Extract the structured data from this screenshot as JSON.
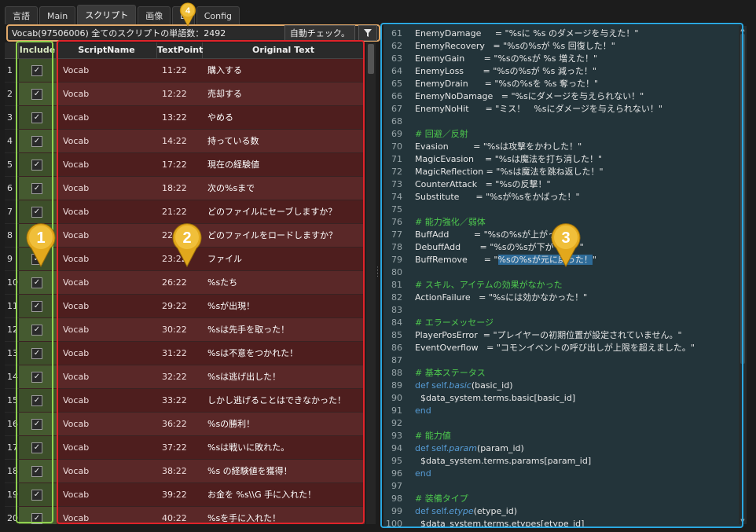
{
  "tabs": [
    "言語",
    "Main",
    "スクリプト",
    "画像",
    "D",
    "Config"
  ],
  "active_tab_index": 2,
  "toolbar": {
    "summary": "Vocab(97506006)  全てのスクリプトの単語数：2492",
    "auto_check_label": "自動チェック。",
    "filter_icon": "filter-icon"
  },
  "grid": {
    "headers": {
      "include": "Include",
      "script_name": "ScriptName",
      "text_point": "TextPoint",
      "original_text": "Original Text"
    },
    "rows": [
      {
        "idx": "1",
        "name": "Vocab",
        "tp": "11:22",
        "text": "購入する"
      },
      {
        "idx": "2",
        "name": "Vocab",
        "tp": "12:22",
        "text": "売却する"
      },
      {
        "idx": "3",
        "name": "Vocab",
        "tp": "13:22",
        "text": "やめる"
      },
      {
        "idx": "4",
        "name": "Vocab",
        "tp": "14:22",
        "text": "持っている数"
      },
      {
        "idx": "5",
        "name": "Vocab",
        "tp": "17:22",
        "text": "現在の経験値"
      },
      {
        "idx": "6",
        "name": "Vocab",
        "tp": "18:22",
        "text": "次の%sまで"
      },
      {
        "idx": "7",
        "name": "Vocab",
        "tp": "21:22",
        "text": "どのファイルにセーブしますか？"
      },
      {
        "idx": "8",
        "name": "Vocab",
        "tp": "22:22",
        "text": "どのファイルをロードしますか？"
      },
      {
        "idx": "9",
        "name": "Vocab",
        "tp": "23:22",
        "text": "ファイル"
      },
      {
        "idx": "10",
        "name": "Vocab",
        "tp": "26:22",
        "text": "%sたち"
      },
      {
        "idx": "11",
        "name": "Vocab",
        "tp": "29:22",
        "text": "%sが出現！"
      },
      {
        "idx": "12",
        "name": "Vocab",
        "tp": "30:22",
        "text": "%sは先手を取った！"
      },
      {
        "idx": "13",
        "name": "Vocab",
        "tp": "31:22",
        "text": "%sは不意をつかれた！"
      },
      {
        "idx": "14",
        "name": "Vocab",
        "tp": "32:22",
        "text": "%sは逃げ出した！"
      },
      {
        "idx": "15",
        "name": "Vocab",
        "tp": "33:22",
        "text": "しかし逃げることはできなかった！"
      },
      {
        "idx": "16",
        "name": "Vocab",
        "tp": "36:22",
        "text": "%sの勝利！"
      },
      {
        "idx": "17",
        "name": "Vocab",
        "tp": "37:22",
        "text": "%sは戦いに敗れた。"
      },
      {
        "idx": "18",
        "name": "Vocab",
        "tp": "38:22",
        "text": "%s の経験値を獲得！"
      },
      {
        "idx": "19",
        "name": "Vocab",
        "tp": "39:22",
        "text": "お金を %s\\\\G 手に入れた！"
      },
      {
        "idx": "20",
        "name": "Vocab",
        "tp": "40:22",
        "text": "%sを手に入れた！"
      }
    ]
  },
  "editor": {
    "lines": [
      {
        "n": "61",
        "parts": [
          {
            "t": "EnemyDamage     = \"%sに %s のダメージを与えた！\""
          }
        ]
      },
      {
        "n": "62",
        "parts": [
          {
            "t": "EnemyRecovery   = \"%sの%sが %s 回復した！\""
          }
        ]
      },
      {
        "n": "63",
        "parts": [
          {
            "t": "EnemyGain       = \"%sの%sが %s 増えた！\""
          }
        ]
      },
      {
        "n": "64",
        "parts": [
          {
            "t": "EnemyLoss       = \"%sの%sが %s 減った！\""
          }
        ]
      },
      {
        "n": "65",
        "parts": [
          {
            "t": "EnemyDrain      = \"%sの%sを %s 奪った！\""
          }
        ]
      },
      {
        "n": "66",
        "parts": [
          {
            "t": "EnemyNoDamage   = \"%sにダメージを与えられない！\""
          }
        ]
      },
      {
        "n": "67",
        "parts": [
          {
            "t": "EnemyNoHit      = \"ミス！　%sにダメージを与えられない！\""
          }
        ]
      },
      {
        "n": "68",
        "parts": []
      },
      {
        "n": "69",
        "parts": [
          {
            "t": "# 回避／反射",
            "c": "cm"
          }
        ]
      },
      {
        "n": "70",
        "parts": [
          {
            "t": "Evasion         = \"%sは攻撃をかわした！\""
          }
        ]
      },
      {
        "n": "71",
        "parts": [
          {
            "t": "MagicEvasion    = \"%sは魔法を打ち消した！\""
          }
        ]
      },
      {
        "n": "72",
        "parts": [
          {
            "t": "MagicReflection = \"%sは魔法を跳ね返した！\""
          }
        ]
      },
      {
        "n": "73",
        "parts": [
          {
            "t": "CounterAttack   = \"%sの反撃！\""
          }
        ]
      },
      {
        "n": "74",
        "parts": [
          {
            "t": "Substitute      = \"%sが%sをかばった！\""
          }
        ]
      },
      {
        "n": "75",
        "parts": []
      },
      {
        "n": "76",
        "parts": [
          {
            "t": "# 能力強化／弱体",
            "c": "cm"
          }
        ]
      },
      {
        "n": "77",
        "parts": [
          {
            "t": "BuffAdd         = \"%sの%sが上がった！\""
          }
        ]
      },
      {
        "n": "78",
        "parts": [
          {
            "t": "DebuffAdd       = \"%sの%sが下がった！\""
          }
        ]
      },
      {
        "n": "79",
        "parts": [
          {
            "t": "BuffRemove      = \""
          },
          {
            "t": "%sの%sが元に戻った！",
            "c": "sel"
          },
          {
            "t": "\""
          }
        ]
      },
      {
        "n": "80",
        "parts": []
      },
      {
        "n": "81",
        "parts": [
          {
            "t": "# スキル、アイテムの効果がなかった",
            "c": "cm"
          }
        ]
      },
      {
        "n": "82",
        "parts": [
          {
            "t": "ActionFailure   = \"%sには効かなかった！\""
          }
        ]
      },
      {
        "n": "83",
        "parts": []
      },
      {
        "n": "84",
        "parts": [
          {
            "t": "# エラーメッセージ",
            "c": "cm"
          }
        ]
      },
      {
        "n": "85",
        "parts": [
          {
            "t": "PlayerPosError  = \"プレイヤーの初期位置が設定されていません。\""
          }
        ]
      },
      {
        "n": "86",
        "parts": [
          {
            "t": "EventOverflow   = \"コモンイベントの呼び出しが上限を超えました。\""
          }
        ]
      },
      {
        "n": "87",
        "parts": []
      },
      {
        "n": "88",
        "parts": [
          {
            "t": "# 基本ステータス",
            "c": "cm"
          }
        ]
      },
      {
        "n": "89",
        "parts": [
          {
            "t": "def ",
            "c": "kw"
          },
          {
            "t": "self.",
            "c": "kw"
          },
          {
            "t": "basic",
            "c": "fn"
          },
          {
            "t": "(basic_id)"
          }
        ]
      },
      {
        "n": "90",
        "parts": [
          {
            "t": "  $data_system.terms.basic[basic_id]"
          }
        ]
      },
      {
        "n": "91",
        "parts": [
          {
            "t": "end",
            "c": "kw"
          }
        ]
      },
      {
        "n": "92",
        "parts": []
      },
      {
        "n": "93",
        "parts": [
          {
            "t": "# 能力値",
            "c": "cm"
          }
        ]
      },
      {
        "n": "94",
        "parts": [
          {
            "t": "def ",
            "c": "kw"
          },
          {
            "t": "self.",
            "c": "kw"
          },
          {
            "t": "param",
            "c": "fn"
          },
          {
            "t": "(param_id)"
          }
        ]
      },
      {
        "n": "95",
        "parts": [
          {
            "t": "  $data_system.terms.params[param_id]"
          }
        ]
      },
      {
        "n": "96",
        "parts": [
          {
            "t": "end",
            "c": "kw"
          }
        ]
      },
      {
        "n": "97",
        "parts": []
      },
      {
        "n": "98",
        "parts": [
          {
            "t": "# 装備タイプ",
            "c": "cm"
          }
        ]
      },
      {
        "n": "99",
        "parts": [
          {
            "t": "def ",
            "c": "kw"
          },
          {
            "t": "self.",
            "c": "kw"
          },
          {
            "t": "etype",
            "c": "fn"
          },
          {
            "t": "(etype_id)"
          }
        ]
      },
      {
        "n": "100",
        "parts": [
          {
            "t": "  $data_system.terms.etypes[etype_id]"
          }
        ]
      }
    ]
  },
  "markers": [
    {
      "label": "1",
      "color": "#e2a81c"
    },
    {
      "label": "2",
      "color": "#e2a81c"
    },
    {
      "label": "3",
      "color": "#e2a81c"
    },
    {
      "label": "4",
      "color": "#e2a81c"
    }
  ],
  "colors": {
    "include_box": "#8fd14f",
    "grid_box": "#e0232a",
    "editor_box": "#2aa7e0",
    "toolbar_box": "#e0a86a"
  }
}
